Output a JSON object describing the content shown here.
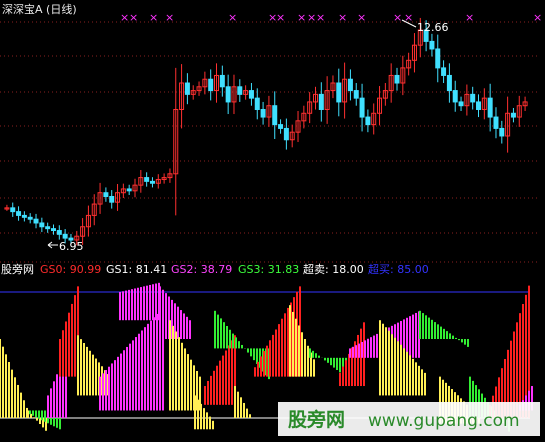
{
  "price_panel": {
    "title": "深深宝A (日线)",
    "high_label": "12.66",
    "low_label": "6.95",
    "price_min": 6.95,
    "price_max": 12.66,
    "cross_marks": 16
  },
  "indicator_panel": {
    "name": "股旁网",
    "items": [
      {
        "label": "GS0: 90.99",
        "color": "#ff2b2b"
      },
      {
        "label": "GS1: 81.41",
        "color": "#ffffff"
      },
      {
        "label": "GS2: 38.79",
        "color": "#ff44ff"
      },
      {
        "label": "GS3: 31.83",
        "color": "#3cff3c"
      },
      {
        "label": "超卖: 18.00",
        "color": "#ffffff"
      },
      {
        "label": "超买: 85.00",
        "color": "#3333ff"
      }
    ],
    "overbought": 85,
    "oversold": 18
  },
  "watermark": {
    "text1": "股旁网",
    "text2": "www.gupang.com"
  },
  "colors": {
    "up": "#ff3030",
    "down": "#40e0ff",
    "magenta": "#ff33ff",
    "green": "#33ee33",
    "yellow": "#ffee55",
    "red": "#ff2020",
    "grid": "#8a2020"
  },
  "chart_data": {
    "type": "candlestick+oscillator",
    "price": {
      "close": [
        7.8,
        7.7,
        7.6,
        7.55,
        7.5,
        7.4,
        7.3,
        7.25,
        7.2,
        7.1,
        7.0,
        6.95,
        7.05,
        7.3,
        7.6,
        7.9,
        8.2,
        8.1,
        7.95,
        8.2,
        8.3,
        8.25,
        8.4,
        8.6,
        8.5,
        8.45,
        8.55,
        8.6,
        8.7,
        10.4,
        11.1,
        10.8,
        10.9,
        11.0,
        11.2,
        10.9,
        11.3,
        11.0,
        10.6,
        11.0,
        10.8,
        10.9,
        10.7,
        10.4,
        10.2,
        10.5,
        10.0,
        9.9,
        9.6,
        9.8,
        10.1,
        10.3,
        10.6,
        10.8,
        10.4,
        10.9,
        11.1,
        10.6,
        11.2,
        10.9,
        10.7,
        10.2,
        10.0,
        10.3,
        10.7,
        10.9,
        11.3,
        11.1,
        11.5,
        11.7,
        12.1,
        12.5,
        12.2,
        12.0,
        11.5,
        11.3,
        10.9,
        10.6,
        10.5,
        10.8,
        10.6,
        10.4,
        10.7,
        10.2,
        9.9,
        9.7,
        10.3,
        10.2,
        10.5,
        10.6
      ],
      "high": 12.66,
      "low": 6.95
    },
    "indicator": {
      "GS0": 90.99,
      "GS1": 81.41,
      "GS2": 38.79,
      "GS3": 31.83,
      "oversold": 18,
      "overbought": 85
    },
    "title": "深深宝A (日线)"
  }
}
